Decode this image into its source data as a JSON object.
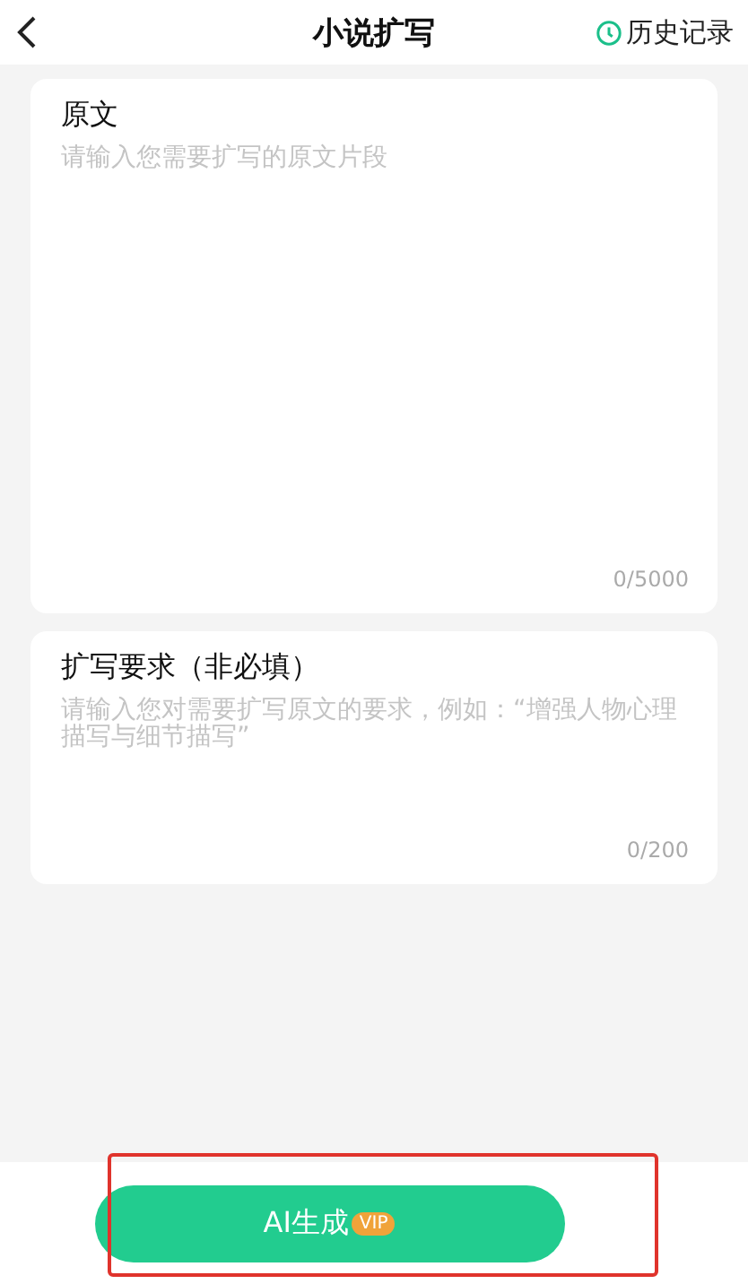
{
  "header": {
    "title": "小说扩写",
    "history": "历史记录"
  },
  "fields": [
    {
      "label": "原文",
      "placeholder": "请输入您需要扩写的原文片段",
      "counter": "0/5000",
      "kind": "large"
    },
    {
      "label": "扩写要求（非必填）",
      "placeholder": "请输入您对需要扩写原文的要求，例如：“增强人物心理描写与细节描写”",
      "counter": "0/200",
      "kind": "small"
    }
  ],
  "generate_button": {
    "label": "AI生成",
    "badge": "VIP",
    "highlighted": true
  }
}
